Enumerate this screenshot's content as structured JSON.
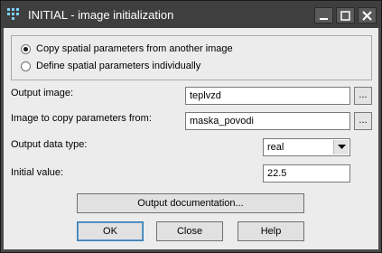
{
  "window": {
    "title": "INITIAL - image initialization",
    "controls": [
      "minimize-icon",
      "maximize-icon",
      "close-icon"
    ]
  },
  "spatial_options": {
    "selected": 0,
    "items": [
      {
        "label": "Copy spatial parameters from another image"
      },
      {
        "label": "Define spatial parameters individually"
      }
    ]
  },
  "fields": {
    "output_image": {
      "label": "Output image:",
      "value": "teplvzd",
      "browse_label": "..."
    },
    "copy_from": {
      "label": "Image to copy parameters from:",
      "value": "maska_povodi",
      "browse_label": "..."
    },
    "data_type": {
      "label": "Output data type:",
      "value": "real"
    },
    "initial_value": {
      "label": "Initial value:",
      "value": "22.5"
    }
  },
  "buttons": {
    "documentation": "Output documentation...",
    "ok": "OK",
    "close": "Close",
    "help": "Help"
  },
  "colors": {
    "titlebar": "#3f3f3f",
    "client": "#ececec",
    "default_button_border": "#3c7fb1"
  }
}
